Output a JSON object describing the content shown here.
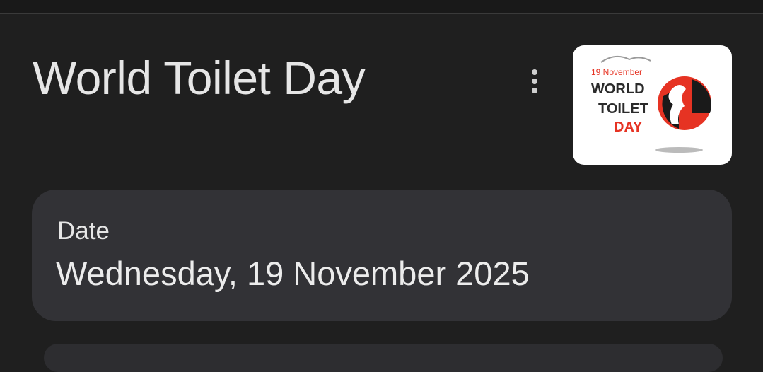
{
  "event": {
    "title": "World Toilet Day",
    "more_options_icon": "more-vert-icon"
  },
  "thumbnail": {
    "date_text": "19 November",
    "line1": "WORLD",
    "line2": "TOILET",
    "line3": "DAY",
    "accent_color": "#e63323"
  },
  "date_card": {
    "label": "Date",
    "value": "Wednesday, 19 November 2025"
  }
}
